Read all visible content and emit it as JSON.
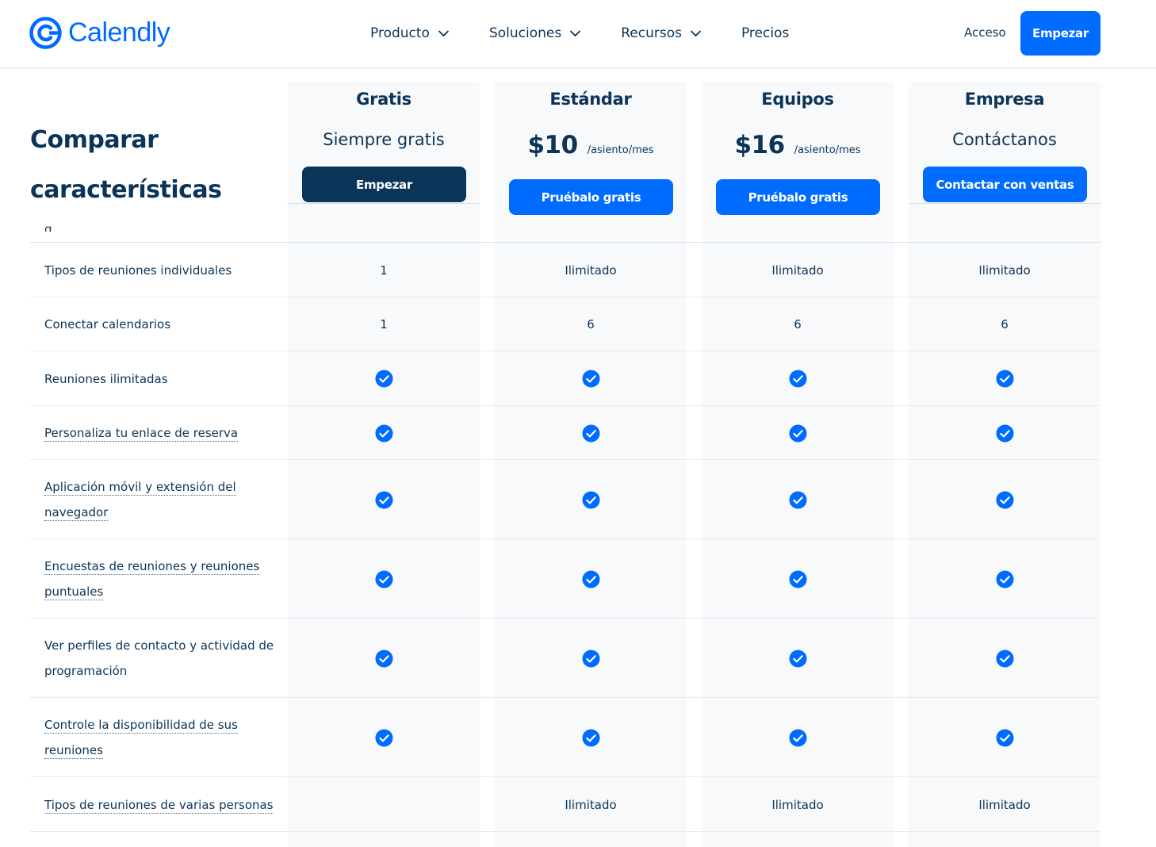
{
  "header": {
    "brand": "Calendly",
    "nav": [
      {
        "label": "Producto",
        "dropdown": true
      },
      {
        "label": "Soluciones",
        "dropdown": true
      },
      {
        "label": "Recursos",
        "dropdown": true
      },
      {
        "label": "Precios",
        "dropdown": false
      }
    ],
    "login_label": "Acceso",
    "start_label": "Empezar"
  },
  "section": {
    "title_line1": "Comparar",
    "title_line2": "características"
  },
  "plans": [
    {
      "name": "Gratis",
      "subtitle": "Siempre gratis",
      "cta": "Empezar"
    },
    {
      "name": "Estándar",
      "price": "$10",
      "unit": "/asiento/mes",
      "cta": "Pruébalo gratis"
    },
    {
      "name": "Equipos",
      "price": "$16",
      "unit": "/asiento/mes",
      "cta": "Pruébalo gratis"
    },
    {
      "name": "Empresa",
      "subtitle": "Contáctanos",
      "cta": "Contactar con ventas"
    }
  ],
  "features": [
    {
      "label": "Tipos de reuniones individuales",
      "values": [
        "1",
        "Ilimitado",
        "Ilimitado",
        "Ilimitado"
      ]
    },
    {
      "label": "Conectar calendarios",
      "values": [
        "1",
        "6",
        "6",
        "6"
      ]
    },
    {
      "label": "Reuniones ilimitadas",
      "values": [
        "check",
        "check",
        "check",
        "check"
      ]
    },
    {
      "label": "Personaliza tu enlace de reserva",
      "values": [
        "check",
        "check",
        "check",
        "check"
      ]
    },
    {
      "label_line1": "Aplicación móvil y extensión del",
      "label_line2": "navegador",
      "values": [
        "check",
        "check",
        "check",
        "check"
      ]
    },
    {
      "label_line1": "Encuestas de reuniones y reuniones",
      "label_line2": "puntuales",
      "values": [
        "check",
        "check",
        "check",
        "check"
      ]
    },
    {
      "label_line1": "Ver perfiles de contacto y actividad de",
      "label_line2": "programación",
      "values": [
        "check",
        "check",
        "check",
        "check"
      ]
    },
    {
      "label_line1": "Controle la disponibilidad de sus",
      "label_line2": "reuniones",
      "values": [
        "check",
        "check",
        "check",
        "check"
      ]
    },
    {
      "label": "Tipos de reuniones de varias personas",
      "values": [
        "",
        "Ilimitado",
        "Ilimitado",
        "Ilimitado"
      ]
    }
  ],
  "icons": {
    "check": "check-circle-icon",
    "chevron": "chevron-down-icon",
    "logo": "calendly-logo-icon"
  },
  "colors": {
    "brand_blue": "#006bff",
    "navy": "#0b3558",
    "column_bg": "#f8f9fb"
  }
}
